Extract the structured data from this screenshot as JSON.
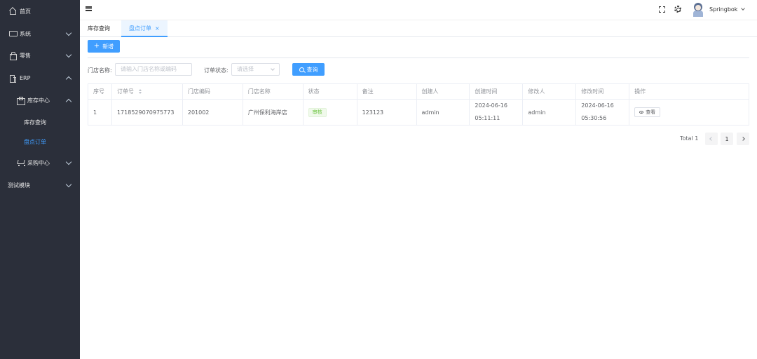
{
  "sidebar": {
    "items": [
      {
        "label": "首页",
        "icon": "home-icon"
      },
      {
        "label": "系统",
        "icon": "monitor-icon"
      },
      {
        "label": "零售",
        "icon": "bag-icon"
      },
      {
        "label": "ERP",
        "icon": "building-icon"
      },
      {
        "label": "库存中心",
        "icon": "box-icon"
      },
      {
        "label": "库存查询"
      },
      {
        "label": "盘点订单"
      },
      {
        "label": "采购中心",
        "icon": "cart-icon"
      },
      {
        "label": "测试模块"
      }
    ],
    "active_color": "#409eff",
    "bg_color": "#2b2f3a"
  },
  "navbar": {
    "username": "Springbok"
  },
  "tags": {
    "tab1": "库存查询",
    "tab2": "盘点订单",
    "close": "×"
  },
  "toolbar": {
    "add_label": "新增",
    "add_plus": "+"
  },
  "filters": {
    "store_label": "门店名称:",
    "store_placeholder": "请输入门店名称或编码",
    "status_label": "订单状态:",
    "status_placeholder": "请选择",
    "search_label": "查询"
  },
  "table": {
    "headers": [
      "序号",
      "订单号",
      "门店编码",
      "门店名称",
      "状态",
      "备注",
      "创建人",
      "创建时间",
      "修改人",
      "修改时间",
      "操作"
    ],
    "rows": [
      {
        "index": "1",
        "order_no": "1718529070975773",
        "store_code": "201002",
        "store_name": "广州保利海岸店",
        "status": "审核",
        "remark": "123123",
        "creator": "admin",
        "created_date": "2024-06-16",
        "created_time": "05:11:11",
        "modifier": "admin",
        "modified_date": "2024-06-16",
        "modified_time": "05:30:56",
        "action": "查看"
      }
    ]
  },
  "pagination": {
    "total": "Total 1",
    "page": "1"
  }
}
